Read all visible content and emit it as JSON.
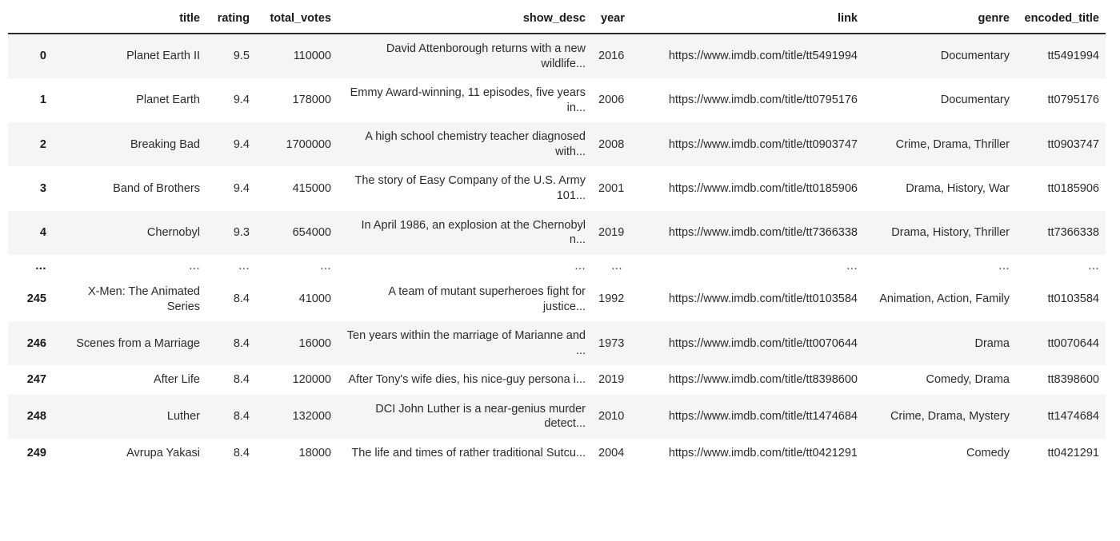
{
  "table": {
    "index_header": "",
    "columns": [
      {
        "key": "title",
        "label": "title"
      },
      {
        "key": "rating",
        "label": "rating"
      },
      {
        "key": "total_votes",
        "label": "total_votes"
      },
      {
        "key": "show_desc",
        "label": "show_desc"
      },
      {
        "key": "year",
        "label": "year"
      },
      {
        "key": "link",
        "label": "link"
      },
      {
        "key": "genre",
        "label": "genre"
      },
      {
        "key": "encoded_title",
        "label": "encoded_title"
      }
    ],
    "ellipsis": "...",
    "rows": [
      {
        "index": "0",
        "title": "Planet Earth II",
        "rating": "9.5",
        "total_votes": "110000",
        "show_desc": "David Attenborough returns with a new wildlife...",
        "year": "2016",
        "link": "https://www.imdb.com/title/tt5491994",
        "genre": "Documentary",
        "encoded_title": "tt5491994"
      },
      {
        "index": "1",
        "title": "Planet Earth",
        "rating": "9.4",
        "total_votes": "178000",
        "show_desc": "Emmy Award-winning, 11 episodes, five years in...",
        "year": "2006",
        "link": "https://www.imdb.com/title/tt0795176",
        "genre": "Documentary",
        "encoded_title": "tt0795176"
      },
      {
        "index": "2",
        "title": "Breaking Bad",
        "rating": "9.4",
        "total_votes": "1700000",
        "show_desc": "A high school chemistry teacher diagnosed with...",
        "year": "2008",
        "link": "https://www.imdb.com/title/tt0903747",
        "genre": "Crime, Drama, Thriller",
        "encoded_title": "tt0903747"
      },
      {
        "index": "3",
        "title": "Band of Brothers",
        "rating": "9.4",
        "total_votes": "415000",
        "show_desc": "The story of Easy Company of the U.S. Army 101...",
        "year": "2001",
        "link": "https://www.imdb.com/title/tt0185906",
        "genre": "Drama, History, War",
        "encoded_title": "tt0185906"
      },
      {
        "index": "4",
        "title": "Chernobyl",
        "rating": "9.3",
        "total_votes": "654000",
        "show_desc": "In April 1986, an explosion at the Chernobyl n...",
        "year": "2019",
        "link": "https://www.imdb.com/title/tt7366338",
        "genre": "Drama, History, Thriller",
        "encoded_title": "tt7366338"
      },
      {
        "index": "245",
        "title": "X-Men: The Animated Series",
        "rating": "8.4",
        "total_votes": "41000",
        "show_desc": "A team of mutant superheroes fight for justice...",
        "year": "1992",
        "link": "https://www.imdb.com/title/tt0103584",
        "genre": "Animation, Action, Family",
        "encoded_title": "tt0103584"
      },
      {
        "index": "246",
        "title": "Scenes from a Marriage",
        "rating": "8.4",
        "total_votes": "16000",
        "show_desc": "Ten years within the marriage of Marianne and ...",
        "year": "1973",
        "link": "https://www.imdb.com/title/tt0070644",
        "genre": "Drama",
        "encoded_title": "tt0070644"
      },
      {
        "index": "247",
        "title": "After Life",
        "rating": "8.4",
        "total_votes": "120000",
        "show_desc": "After Tony's wife dies, his nice-guy persona i...",
        "year": "2019",
        "link": "https://www.imdb.com/title/tt8398600",
        "genre": "Comedy, Drama",
        "encoded_title": "tt8398600"
      },
      {
        "index": "248",
        "title": "Luther",
        "rating": "8.4",
        "total_votes": "132000",
        "show_desc": "DCI John Luther is a near-genius murder detect...",
        "year": "2010",
        "link": "https://www.imdb.com/title/tt1474684",
        "genre": "Crime, Drama, Mystery",
        "encoded_title": "tt1474684"
      },
      {
        "index": "249",
        "title": "Avrupa Yakasi",
        "rating": "8.4",
        "total_votes": "18000",
        "show_desc": "The life and times of rather traditional Sutcu...",
        "year": "2004",
        "link": "https://www.imdb.com/title/tt0421291",
        "genre": "Comedy",
        "encoded_title": "tt0421291"
      }
    ],
    "ellipsis_row_after_index": 4
  }
}
